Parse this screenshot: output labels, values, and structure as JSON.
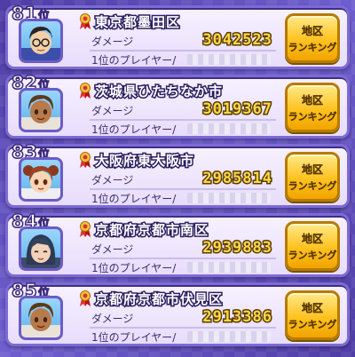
{
  "entries": [
    {
      "rank_num": "81",
      "rank_suffix": "位",
      "area": "東京都墨田区",
      "damage_label": "ダメージ",
      "damage": "3042523",
      "player_label": "1位のプレイヤー/",
      "button_line1": "地区",
      "button_line2": "ランキング",
      "avatar": "boy-glasses-avatar"
    },
    {
      "rank_num": "82",
      "rank_suffix": "位",
      "area": "茨城県ひたちなか市",
      "damage_label": "ダメージ",
      "damage": "3019367",
      "player_label": "1位のプレイヤー/",
      "button_line1": "地区",
      "button_line2": "ランキング",
      "avatar": "boy-brown-hair-avatar"
    },
    {
      "rank_num": "83",
      "rank_suffix": "位",
      "area": "大阪府東大阪市",
      "damage_label": "ダメージ",
      "damage": "2985814",
      "player_label": "1位のプレイヤー/",
      "button_line1": "地区",
      "button_line2": "ランキング",
      "avatar": "girl-pigtails-avatar"
    },
    {
      "rank_num": "84",
      "rank_suffix": "位",
      "area": "京都府京都市南区",
      "damage_label": "ダメージ",
      "damage": "2939883",
      "player_label": "1位のプレイヤー/",
      "button_line1": "地区",
      "button_line2": "ランキング",
      "avatar": "girl-dark-hair-avatar"
    },
    {
      "rank_num": "85",
      "rank_suffix": "位",
      "area": "京都府京都市伏見区",
      "damage_label": "ダメージ",
      "damage": "2913386",
      "player_label": "1位のプレイヤー/",
      "button_line1": "地区",
      "button_line2": "ランキング",
      "avatar": "boy-brown-hair-avatar"
    }
  ],
  "colors": {
    "card_border": "#7d6ad6",
    "damage_text": "#ffd84a",
    "button": "#ffc21f",
    "background": "#5a48b8"
  }
}
